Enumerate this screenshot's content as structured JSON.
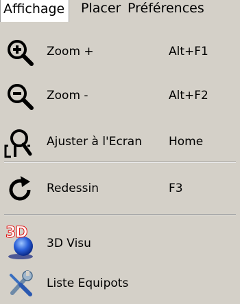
{
  "menubar": {
    "items": [
      {
        "label": "Affichage"
      },
      {
        "label": "Placer"
      },
      {
        "label": "Préférences"
      }
    ]
  },
  "menu": {
    "items": [
      {
        "label": "Zoom +",
        "shortcut": "Alt+F1",
        "icon": "zoom-in-icon"
      },
      {
        "label": "Zoom -",
        "shortcut": "Alt+F2",
        "icon": "zoom-out-icon"
      },
      {
        "label": "Ajuster à l'Ecran",
        "shortcut": "Home",
        "icon": "zoom-fit-icon"
      },
      {
        "label": "Redessin",
        "shortcut": "F3",
        "icon": "redraw-icon"
      },
      {
        "label": "3D Visu",
        "shortcut": "",
        "icon": "3d-visu-icon",
        "badge": "3D"
      },
      {
        "label": "Liste Equipots",
        "shortcut": "",
        "icon": "tools-icon"
      }
    ]
  },
  "colors": {
    "menu_background": "#d4d0c8",
    "active_menubar_item": "#ffffff",
    "badge_red": "#e01010",
    "globe_blue": "#1f4fd0"
  }
}
